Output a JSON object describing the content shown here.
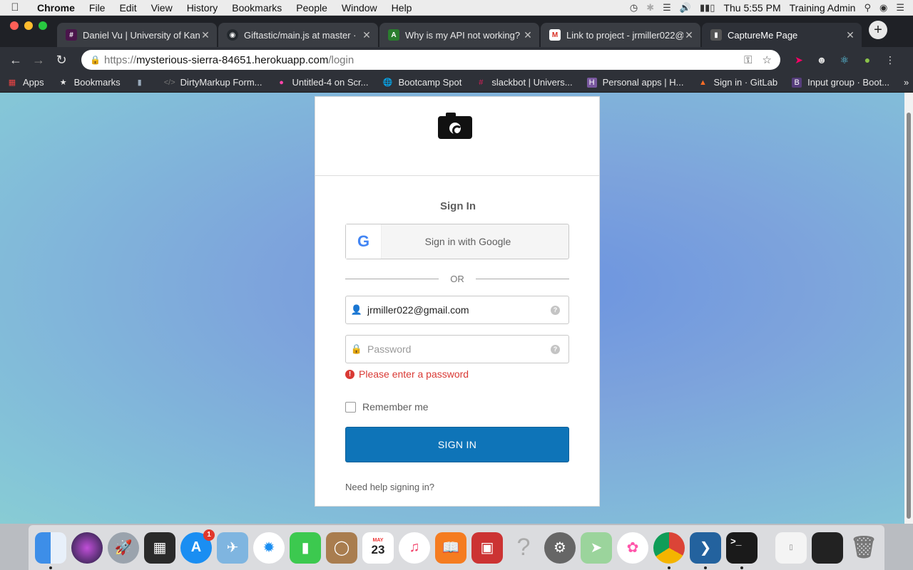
{
  "menubar": {
    "app": "Chrome",
    "items": [
      "File",
      "Edit",
      "View",
      "History",
      "Bookmarks",
      "People",
      "Window",
      "Help"
    ],
    "clock": "Thu 5:55 PM",
    "user": "Training Admin"
  },
  "tabs": [
    {
      "title": "Daniel Vu | University of Kan",
      "color": "#4a154b"
    },
    {
      "title": "Giftastic/main.js at master ·",
      "color": "#24292e"
    },
    {
      "title": "Why is my API not working?",
      "color": "#2a7d2e"
    },
    {
      "title": "Link to project - jrmiller022@",
      "color": "#d93025"
    },
    {
      "title": "CaptureMe Page",
      "color": "#333333"
    }
  ],
  "omnibox": {
    "scheme": "https://",
    "host": "mysterious-sierra-84651.herokuapp.com",
    "path": "/login"
  },
  "bookmarks": [
    {
      "label": "Apps",
      "icon": "apps-grid-icon"
    },
    {
      "label": "Bookmarks",
      "icon": "star-icon"
    },
    {
      "label": "",
      "icon": "brand-icon"
    },
    {
      "label": "DirtyMarkup Form...",
      "icon": "code-icon"
    },
    {
      "label": "Untitled-4 on Scr...",
      "icon": "scrimba-icon"
    },
    {
      "label": "Bootcamp Spot",
      "icon": "globe-icon"
    },
    {
      "label": "slackbot | Univers...",
      "icon": "slack-icon"
    },
    {
      "label": "Personal apps | H...",
      "icon": "heroku-icon"
    },
    {
      "label": "Sign in · GitLab",
      "icon": "gitlab-icon"
    },
    {
      "label": "Input group · Boot...",
      "icon": "bootstrap-icon"
    }
  ],
  "login": {
    "heading": "Sign In",
    "google_label": "Sign in with Google",
    "divider": "OR",
    "username_value": "jrmiller022@gmail.com",
    "password_placeholder": "Password",
    "error": "Please enter a password",
    "remember_label": "Remember me",
    "submit_label": "SIGN IN",
    "help_link": "Need help signing in?"
  },
  "dock": {
    "appstore_badge": "1",
    "calendar_month": "MAY",
    "calendar_day": "23"
  },
  "colors": {
    "primary_button": "#0e74b8",
    "error": "#d93934"
  }
}
